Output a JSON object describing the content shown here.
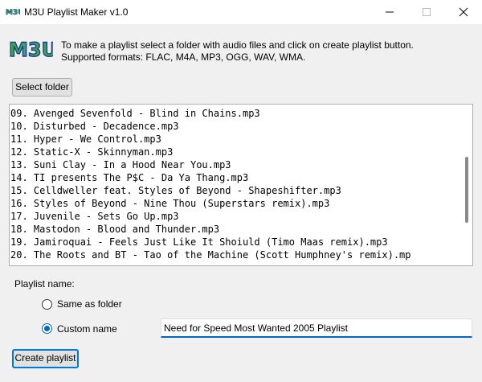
{
  "window": {
    "title": "M3U Playlist Maker v1.0",
    "app_icon": "m3u-logo-icon",
    "controls": [
      "minimize-icon",
      "maximize-icon",
      "close-icon"
    ]
  },
  "logo": {
    "text": "M3U"
  },
  "intro": {
    "line1": "To make a playlist select a folder with audio files and click on create playlist button.",
    "line2": "Supported formats: FLAC, M4A, MP3, OGG, WAV, WMA."
  },
  "select_folder_label": "Select folder",
  "files": [
    "09. Avenged Sevenfold - Blind in Chains.mp3",
    "10. Disturbed - Decadence.mp3",
    "11. Hyper - We Control.mp3",
    "12. Static-X - Skinnyman.mp3",
    "13. Suni Clay - In a Hood Near You.mp3",
    "14. TI presents The P$C - Da Ya Thang.mp3",
    "15. Celldweller feat. Styles of Beyond - Shapeshifter.mp3",
    "16. Styles of Beyond - Nine Thou (Superstars remix).mp3",
    "17. Juvenile - Sets Go Up.mp3",
    "18. Mastodon - Blood and Thunder.mp3",
    "19. Jamiroquai - Feels Just Like It Shoiuld (Timo Maas remix).mp3",
    "20. The Roots and BT - Tao of the Machine (Scott Humphney's remix).mp"
  ],
  "playlist_name": {
    "label": "Playlist name:",
    "option_same": "Same as folder",
    "option_custom": "Custom name",
    "selected": "custom",
    "value": "Need for Speed Most Wanted 2005 Playlist"
  },
  "create_label": "Create playlist",
  "colors": {
    "accent": "#0067c0",
    "focus": "#0078d7",
    "logo_fill": "#3aa84a"
  }
}
